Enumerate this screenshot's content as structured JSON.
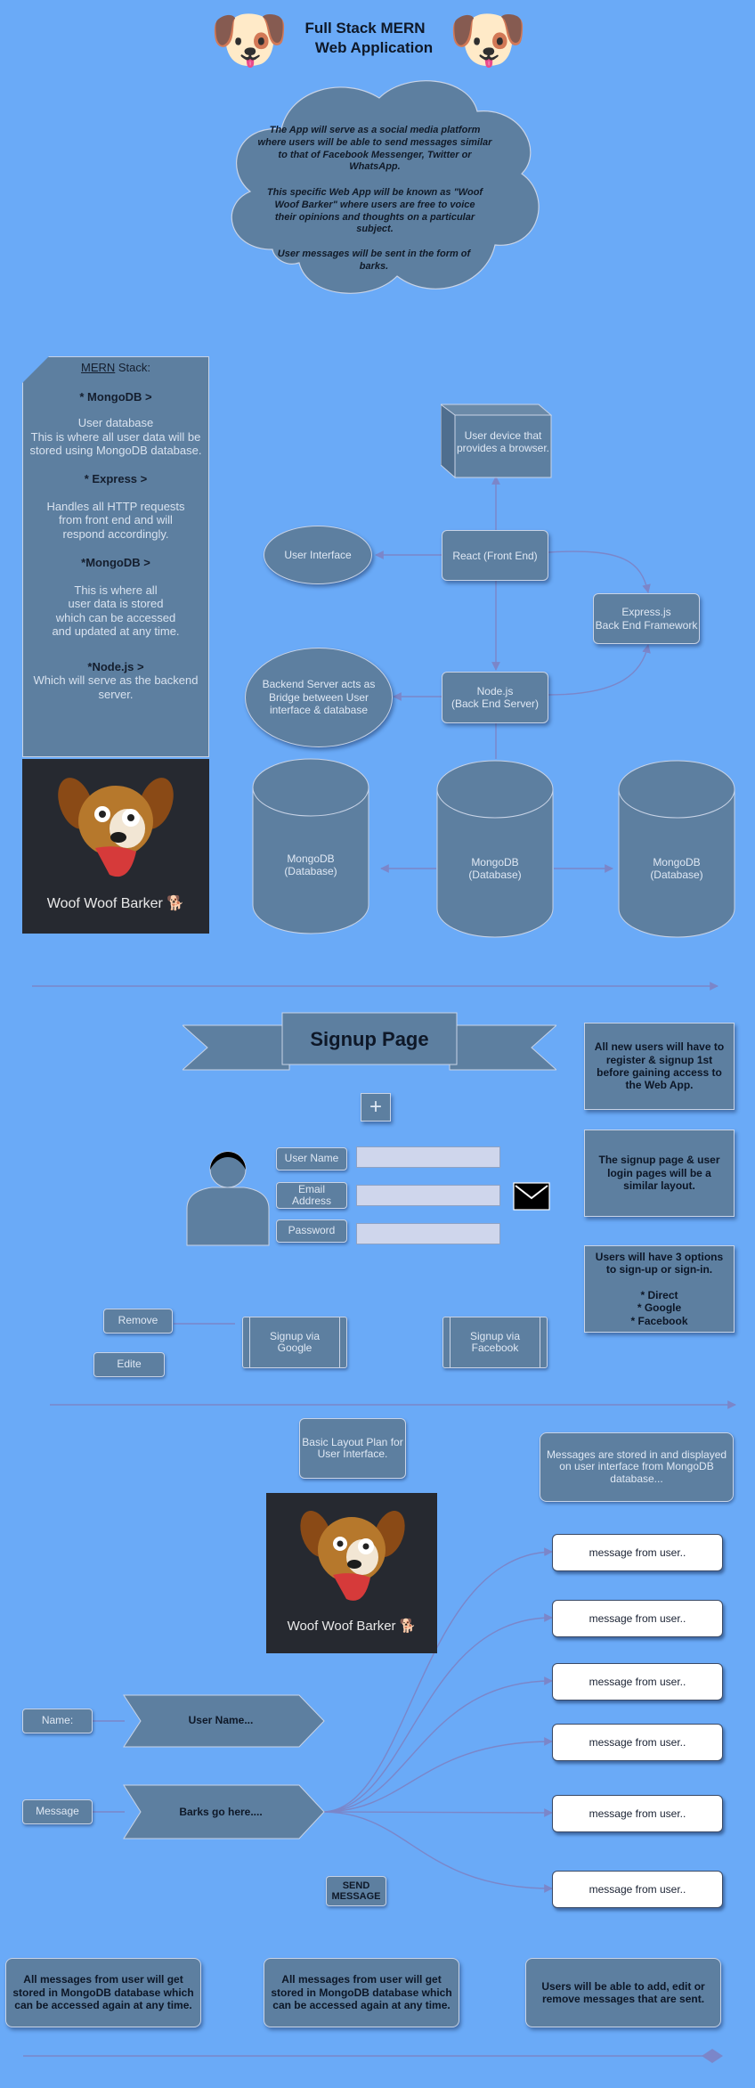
{
  "header": {
    "title_line1": "Full Stack MERN",
    "title_line2": "Web Application",
    "dog_emoji": "🐶"
  },
  "cloud": {
    "p1": "The App will serve as a social media platform where users will be able to send messages similar to that of Facebook Messenger, Twitter or  WhatsApp.",
    "p2": "This specific Web App will be known as \"Woof Woof Barker\" where users are free to voice their opinions and thoughts on a particular subject.",
    "p3": "User messages will be sent in the form of barks."
  },
  "stack_panel": {
    "heading_u": "MERN",
    "heading_rest": " Stack:",
    "mongo_title": "* MongoDB >",
    "mongo_text": "User database\nThis is where all user data will be stored using MongoDB database.",
    "express_title": "* Express >",
    "express_text": "Handles all HTTP requests from front end and will respond accordingly.",
    "mongo2_title": "*MongoDB >",
    "mongo2_text": "This is where all\nuser data is stored\nwhich can be accessed\nand updated at any time.",
    "node_title": "*Node.js >",
    "node_text": "Which will serve as the backend\nserver."
  },
  "logo": {
    "text": "Woof Woof Barker",
    "emoji": "🐕"
  },
  "arch": {
    "device": "User device that provides a browser.",
    "ui": "User Interface",
    "react": "React (Front End)",
    "express": "Express.js\nBack End Framework",
    "backend": "Backend Server acts as\nBridge between User\ninterface & database",
    "node": "Node.js\n(Back End Server)",
    "db": "MongoDB\n(Database)"
  },
  "signup": {
    "banner": "Signup Page",
    "plus": "+",
    "user_name": "User Name",
    "email": "Email\nAddress",
    "password": "Password",
    "remove": "Remove",
    "edit": "Edite",
    "google": "Signup via\nGoogle",
    "facebook": "Signup via\nFacebook",
    "note1": "All new users will have to register & signup 1st before gaining access to the Web App.",
    "note2": "The signup page & user login pages will be a similar layout.",
    "note3": "Users will have 3 options to sign-up or sign-in.\n\n* Direct\n* Google\n* Facebook"
  },
  "layout": {
    "plan": "Basic Layout Plan for User Interface.",
    "stored_note": "Messages are stored in and displayed on user interface from MongoDB database...",
    "name_label": "Name:",
    "name_value": "User Name...",
    "message_label": "Message",
    "message_value": "Barks go here....",
    "send": "SEND\nMESSAGE",
    "messages": [
      "message from user..",
      "message from user..",
      "message from user..",
      "message from user..",
      "message from user..",
      "message from user.."
    ]
  },
  "footer": {
    "note1": "All messages from user will get stored in MongoDB database which can be accessed again at any time.",
    "note2": "All messages from user will get stored in MongoDB database which can be accessed again at any time.",
    "note3": "Users will be able to add, edit or remove messages that are sent."
  },
  "colors": {
    "background": "#6aaaf7",
    "shape": "#5d7fa0",
    "connector": "#7b86c9"
  }
}
